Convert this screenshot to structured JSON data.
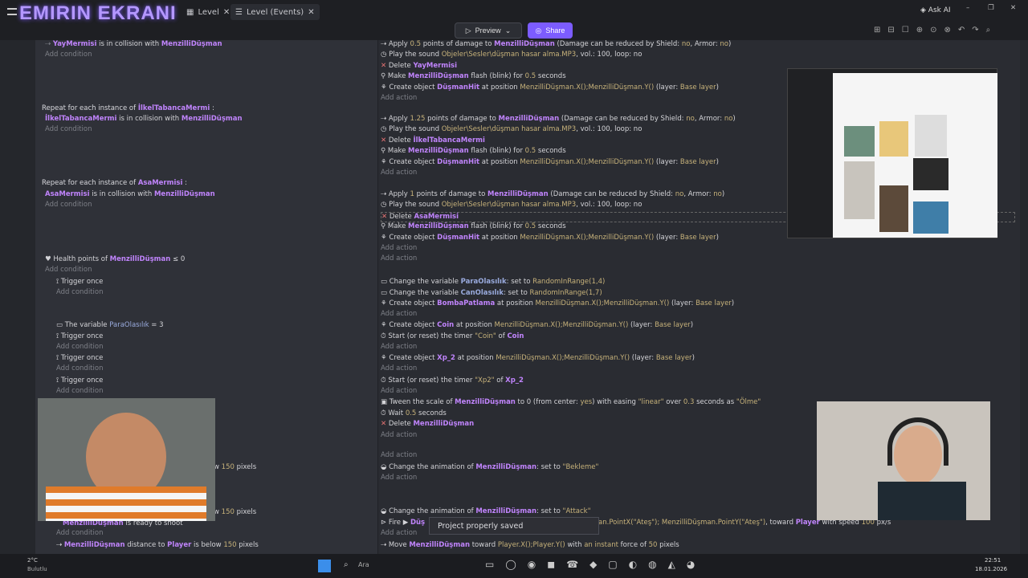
{
  "brand": "EMIRIN EKRANI",
  "tabs": [
    "Level",
    "Level (Events)"
  ],
  "preview_label": "Preview",
  "share_label": "Share",
  "ask_ai": "Ask AI",
  "toast": "Project properly saved",
  "weather": {
    "temp": "2°C",
    "cond": "Bulutlu"
  },
  "clock": {
    "time": "22:51",
    "date": "18.01.2026"
  },
  "search_ph": "Ara",
  "rows": [
    {
      "t": "collision",
      "txt": "YayMermisi is in collision with MenzilliDüşman"
    },
    {
      "t": "cond",
      "txt": "Add condition"
    },
    {
      "t": "repeat",
      "txt": "Repeat for each instance of İlkelTabancaMermi :"
    },
    {
      "t": "collision",
      "txt": "İlkelTabancaMermi is in collision with MenzilliDüşman"
    },
    {
      "t": "repeat",
      "txt": "Repeat for each instance of AsaMermisi :"
    },
    {
      "t": "collision",
      "txt": "AsaMermisi is in collision with MenzilliDüşman"
    },
    {
      "t": "hp",
      "txt": "Health points of MenzilliDüşman ≤ 0"
    },
    {
      "t": "trigger",
      "txt": "Trigger once"
    },
    {
      "t": "var",
      "txt": "The variable ParaOlasılık = 3"
    },
    {
      "t": "dist",
      "txt": "MenzilliDüşman distance to Player is below 150 pixels"
    },
    {
      "t": "ready",
      "txt": "MenzilliDüşman is ready to shoot"
    }
  ],
  "actions": [
    "Apply 0.5 points of damage to MenzilliDüşman (Damage can be reduced by Shield: no, Armor: no)",
    "Play the sound Objeler\\Sesler\\düşman hasar alma.MP3, vol.: 100, loop: no",
    "Delete YayMermisi",
    "Make MenzilliDüşman flash (blink) for 0.5 seconds",
    "Create object DüşmanHit at position MenzilliDüşman.X();MenzilliDüşman.Y() (layer: Base layer)",
    "Apply 1.25 points of damage to MenzilliDüşman (Damage can be reduced by Shield: no, Armor: no)",
    "Delete İlkelTabancaMermi",
    "Apply 1 points of damage to MenzilliDüşman (Damage can be reduced by Shield: no, Armor: no)",
    "Delete AsaMermisi",
    "Change the variable ParaOlasılık: set to RandomInRange(1,4)",
    "Change the variable CanOlasılık: set to RandomInRange(1,7)",
    "Create object BombaPatlama at position MenzilliDüşman.X();MenzilliDüşman.Y() (layer: Base layer)",
    "Create object Coin at position MenzilliDüşman.X();MenzilliDüşman.Y() (layer: Base layer)",
    "Start (or reset) the timer \"Coin\" of Coin",
    "Create object Xp_2 at position MenzilliDüşman.X();MenzilliDüşman.Y() (layer: Base layer)",
    "Start (or reset) the timer \"Xp2\" of Xp_2",
    "Tween the scale of MenzilliDüşman to 0 (from center: yes) with easing \"linear\" over 0.3 seconds as \"Ölme\"",
    "Wait 0.5 seconds",
    "Delete MenzilliDüşman",
    "Change the animation of MenzilliDüşman: set to \"Bekleme\"",
    "Change the animation of MenzilliDüşman: set to \"Attack\"",
    "Fire MenzilliDüşman.PointX(\"Ateş\"); MenzilliDüşman.PointY(\"Ateş\"), toward Player with speed 100 px/s",
    "Move MenzilliDüşman toward Player.X();Player.Y() with an instant force of 50 pixels"
  ],
  "add_action": "Add action",
  "add_condition": "Add condition"
}
